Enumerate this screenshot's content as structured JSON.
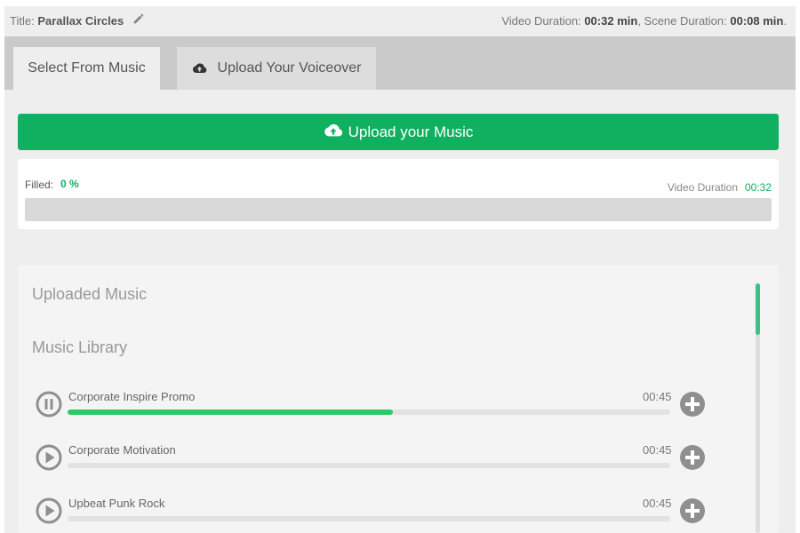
{
  "header": {
    "title_label": "Title:",
    "title_value": "Parallax Circles",
    "video_duration_label": "Video Duration:",
    "video_duration_value": "00:32 min",
    "scene_duration_label": ", Scene Duration:",
    "scene_duration_value": "00:08 min",
    "trailing_period": "."
  },
  "tabs": [
    {
      "label": "Select From Music",
      "active": true
    },
    {
      "label": "Upload Your Voiceover",
      "active": false
    }
  ],
  "upload": {
    "label": "Upload your Music"
  },
  "filled": {
    "label": "Filled:",
    "value": "0 %",
    "fraction": 0,
    "video_duration_label": "Video Duration",
    "video_duration_value": "00:32"
  },
  "sections": {
    "uploaded": "Uploaded Music",
    "library": "Music Library"
  },
  "tracks": [
    {
      "name": "Corporate Inspire Promo",
      "duration": "00:45",
      "state": "playing",
      "progress": 0.54
    },
    {
      "name": "Corporate Motivation",
      "duration": "00:45",
      "state": "paused",
      "progress": 0
    },
    {
      "name": "Upbeat Punk Rock",
      "duration": "00:45",
      "state": "paused",
      "progress": 0
    }
  ],
  "colors": {
    "accent": "#11b060",
    "progress": "#2ec866",
    "icon": "#8f8f8f"
  },
  "icons": {
    "title_edit": "pencil-icon",
    "voiceover_tab": "cloud-upload-icon",
    "upload_button": "cloud-upload-icon",
    "track_playing": "pause-icon",
    "track_paused": "play-icon",
    "track_add": "plus-circle-icon"
  }
}
